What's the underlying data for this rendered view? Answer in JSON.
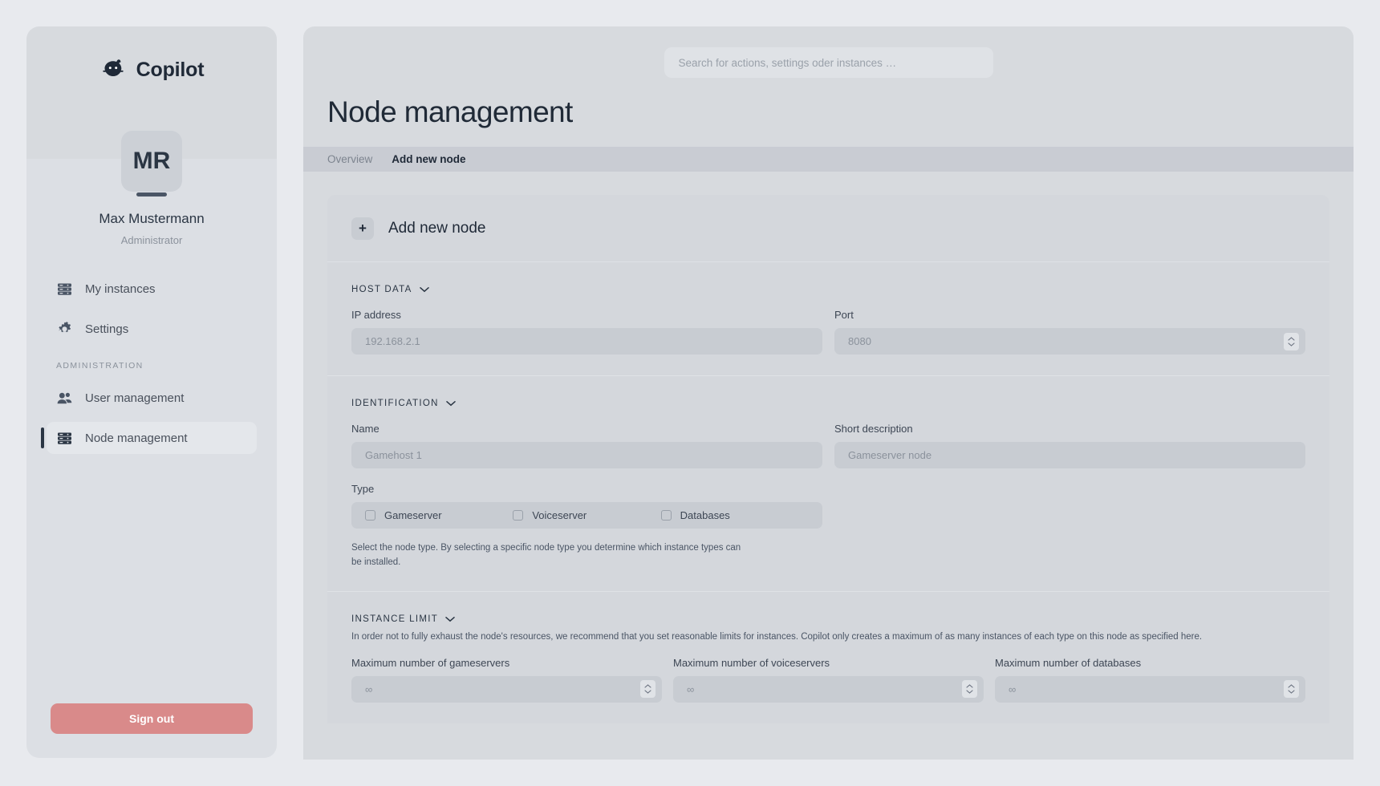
{
  "brand": {
    "name": "Copilot",
    "logo_icon": "copilot-robot-icon"
  },
  "user": {
    "initials": "MR",
    "name": "Max Mustermann",
    "role": "Administrator"
  },
  "sidebar": {
    "items": [
      {
        "label": "My instances",
        "icon": "server-stack-icon",
        "active": false
      },
      {
        "label": "Settings",
        "icon": "gear-icon",
        "active": false
      }
    ],
    "section_title": "ADMINISTRATION",
    "admin_items": [
      {
        "label": "User management",
        "icon": "users-icon",
        "active": false
      },
      {
        "label": "Node management",
        "icon": "server-stack-icon",
        "active": true
      }
    ],
    "sign_out_label": "Sign out",
    "sign_out_color": "#d98a8a"
  },
  "search": {
    "placeholder": "Search for actions, settings oder instances …",
    "value": ""
  },
  "header": {
    "title": "Node management"
  },
  "tabs": [
    {
      "label": "Overview",
      "active": false
    },
    {
      "label": "Add new node",
      "active": true
    }
  ],
  "card": {
    "title": "Add new node",
    "plus_label": "+"
  },
  "sections": {
    "host_data": {
      "title": "HOST DATA",
      "ip": {
        "label": "IP address",
        "placeholder": "192.168.2.1",
        "value": ""
      },
      "port": {
        "label": "Port",
        "placeholder": "8080",
        "value": ""
      }
    },
    "identification": {
      "title": "IDENTIFICATION",
      "name": {
        "label": "Name",
        "placeholder": "Gamehost 1",
        "value": ""
      },
      "short_description": {
        "label": "Short description",
        "placeholder": "Gameserver node",
        "value": ""
      },
      "type": {
        "label": "Type",
        "options": [
          {
            "label": "Gameserver",
            "checked": false
          },
          {
            "label": "Voiceserver",
            "checked": false
          },
          {
            "label": "Databases",
            "checked": false
          }
        ],
        "helper": "Select the node type. By selecting a specific node type you determine which instance types can be installed."
      }
    },
    "instance_limit": {
      "title": "INSTANCE LIMIT",
      "description": "In order not to fully exhaust the node's resources, we recommend that you set reasonable limits for instances. Copilot only creates a maximum of as many instances of each type on this node as specified here.",
      "fields": [
        {
          "label": "Maximum number of gameservers",
          "placeholder": "∞",
          "value": ""
        },
        {
          "label": "Maximum number of voiceservers",
          "placeholder": "∞",
          "value": ""
        },
        {
          "label": "Maximum number of databases",
          "placeholder": "∞",
          "value": ""
        }
      ]
    }
  },
  "colors": {
    "page_bg": "#e8eaee",
    "panel_bg": "#d7dade",
    "card_bg": "#d4d7dc",
    "input_bg": "#c8ccd2",
    "accent_text": "#1f2937"
  }
}
